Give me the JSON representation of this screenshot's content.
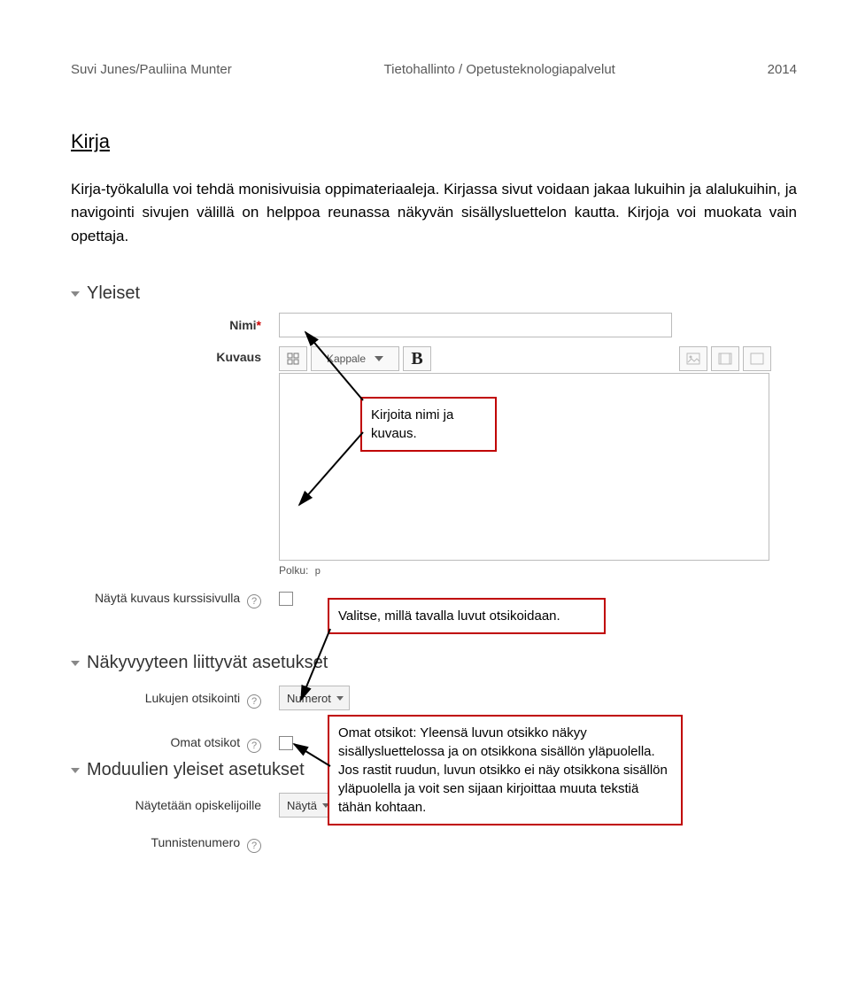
{
  "header": {
    "left": "Suvi Junes/Pauliina Munter",
    "center": "Tietohallinto / Opetusteknologiapalvelut",
    "right": "2014"
  },
  "title": "Kirja",
  "intro": "Kirja-työkalulla voi tehdä monisivuisia oppimateriaaleja. Kirjassa sivut voidaan jakaa lukuihin ja alalukuihin, ja navigointi sivujen välillä on helppoa reunassa näkyvän sisällysluettelon kautta. Kirjoja voi muokata vain opettaja.",
  "sections": {
    "general": "Yleiset",
    "visibility": "Näkyvyyteen liittyvät asetukset",
    "module": "Moduulien yleiset asetukset"
  },
  "labels": {
    "name": "Nimi",
    "asterisk": "*",
    "description": "Kuvaus",
    "show_desc": "Näytä kuvaus kurssisivulla",
    "chapter_numbering": "Lukujen otsikointi",
    "custom_titles": "Omat otsikot",
    "show_students": "Näytetään opiskelijoille",
    "id_number": "Tunnistenumero"
  },
  "toolbar": {
    "paragraph": "Kappale",
    "bold": "B"
  },
  "polku_label": "Polku:",
  "polku_value": "p",
  "help_icon": "?",
  "selects": {
    "numbering": "Numerot",
    "visible": "Näytä"
  },
  "annotations": {
    "a1": "Kirjoita nimi ja kuvaus.",
    "a2": "Valitse, millä tavalla luvut otsikoidaan.",
    "a3": "Omat otsikot: Yleensä luvun otsikko näkyy sisällysluettelossa ja on otsikkona sisällön yläpuolella. Jos rastit ruudun, luvun otsikko ei näy otsikkona sisällön yläpuolella ja voit sen sijaan kirjoittaa muuta tekstiä tähän kohtaan."
  }
}
